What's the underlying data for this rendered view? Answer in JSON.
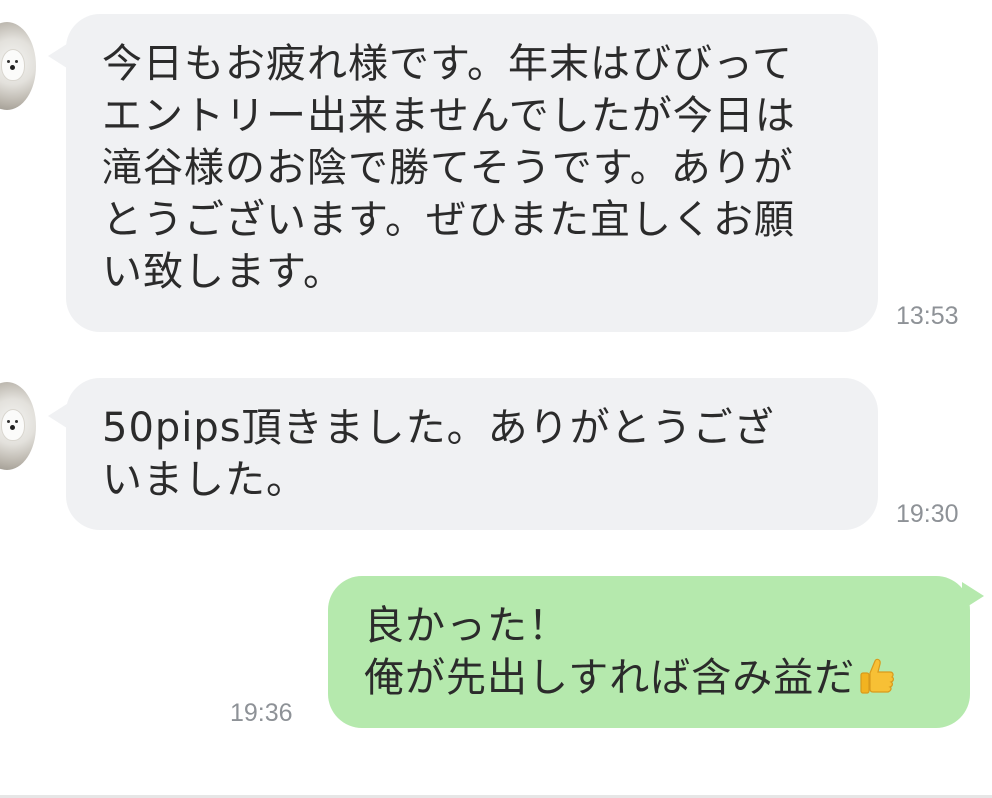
{
  "messages": [
    {
      "direction": "incoming",
      "lines": [
        "今日もお疲れ様です。年末はびびって",
        "エントリー出来ませんでしたが今日は",
        "滝谷様のお陰で勝てそうです。ありが",
        "とうございます。ぜひまた宜しくお願",
        "い致します。"
      ],
      "time": "13:53"
    },
    {
      "direction": "incoming",
      "lines": [
        "50pips頂きました。ありがとうござ",
        "いました。"
      ],
      "time": "19:30"
    },
    {
      "direction": "outgoing",
      "lines": [
        "良かった！",
        "俺が先出しすれば含み益だ"
      ],
      "emoji": "thumbs-up",
      "time": "19:36"
    }
  ],
  "colors": {
    "incoming_bubble": "#f0f1f3",
    "outgoing_bubble": "#b5e9ad",
    "timestamp": "#8e9297"
  }
}
